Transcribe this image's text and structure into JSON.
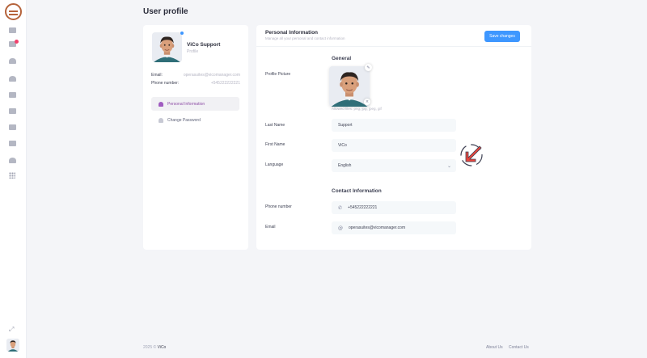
{
  "page": {
    "title": "User profile"
  },
  "sidebar": {
    "items": [
      {
        "name": "home"
      },
      {
        "name": "messages"
      },
      {
        "name": "notifications"
      },
      {
        "name": "users"
      },
      {
        "name": "inbox"
      },
      {
        "name": "documents"
      },
      {
        "name": "reports"
      },
      {
        "name": "settings"
      },
      {
        "name": "tools"
      },
      {
        "name": "apps"
      }
    ]
  },
  "profile": {
    "name": "ViCo Support",
    "role": "Profile",
    "email_label": "Email:",
    "email_value": "operasuites@vicomanager.com",
    "phone_label": "Phone number:",
    "phone_value": "+545222222221"
  },
  "menu": {
    "personal_info": "Personal Information",
    "change_password": "Change Password"
  },
  "form": {
    "title": "Personal Information",
    "subtitle": "Manage all your personal and contact information",
    "save_label": "Save changes",
    "general_title": "General",
    "picture_label": "Profile Picture",
    "picture_hint": "Allowed files: png, jpg, jpeg, gif",
    "last_name_label": "Last Name",
    "last_name_value": "Support",
    "first_name_label": "First Name",
    "first_name_value": "ViCo",
    "language_label": "Language",
    "language_value": "English",
    "contact_title": "Contact Information",
    "phone_label": "Phone number",
    "phone_value": "+545222222221",
    "email_label": "Email",
    "email_value": "operasuites@vicomanager.com"
  },
  "footer": {
    "copyright": "2025 ©",
    "brand": "ViCo",
    "about": "About Us",
    "contact": "Contact Us"
  },
  "colors": {
    "accent": "#3e97ff",
    "active_menu": "#8e4ea6",
    "annotation": "#e8453c"
  }
}
